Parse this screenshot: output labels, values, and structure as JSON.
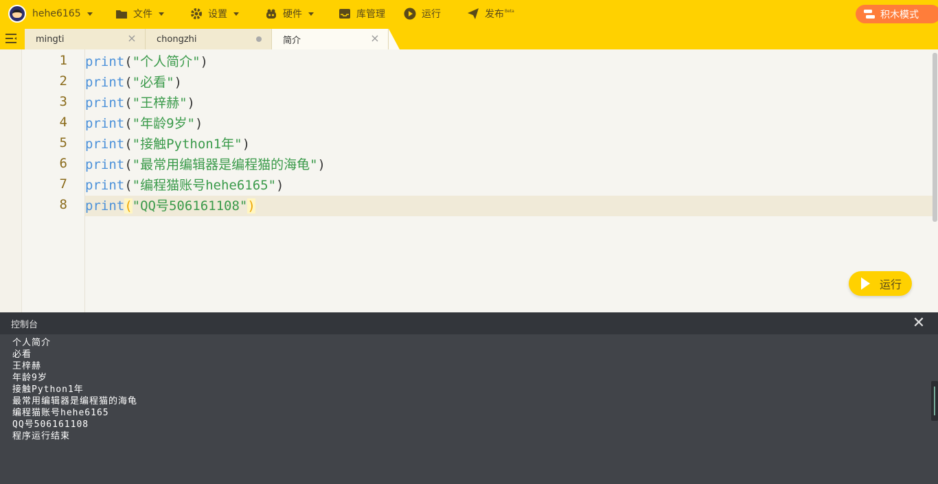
{
  "toolbar": {
    "username": "hehe6165",
    "file": "文件",
    "settings": "设置",
    "hardware": "硬件",
    "library": "库管理",
    "run": "运行",
    "publish": "发布",
    "publish_badge": "Beta",
    "brick_mode": "积木模式"
  },
  "tabs": [
    {
      "label": "mingti",
      "state": "close"
    },
    {
      "label": "chongzhi",
      "state": "modified"
    },
    {
      "label": "简介",
      "state": "close",
      "active": true
    }
  ],
  "editor": {
    "lines": [
      {
        "num": "1",
        "kw": "print",
        "open": "(",
        "str": "\"个人简介\"",
        "close": ")"
      },
      {
        "num": "2",
        "kw": "print",
        "open": "(",
        "str": "\"必看\"",
        "close": ")"
      },
      {
        "num": "3",
        "kw": "print",
        "open": "(",
        "str": "\"王梓赫\"",
        "close": ")"
      },
      {
        "num": "4",
        "kw": "print",
        "open": "(",
        "str": "\"年龄9岁\"",
        "close": ")"
      },
      {
        "num": "5",
        "kw": "print",
        "open": "(",
        "str": "\"接触Python1年\"",
        "close": ")"
      },
      {
        "num": "6",
        "kw": "print",
        "open": "(",
        "str": "\"最常用编辑器是编程猫的海龟\"",
        "close": ")"
      },
      {
        "num": "7",
        "kw": "print",
        "open": "(",
        "str": "\"编程猫账号hehe6165\"",
        "close": ")"
      },
      {
        "num": "8",
        "kw": "print",
        "open": "(",
        "str": "\"QQ号506161108\"",
        "close": ")"
      }
    ],
    "current_line": 8,
    "run_button": "运行"
  },
  "console": {
    "title": "控制台",
    "output": [
      "个人简介",
      "必看",
      "王梓赫",
      "年龄9岁",
      "接触Python1年",
      "最常用编辑器是编程猫的海龟",
      "编程猫账号hehe6165",
      "QQ号506161108",
      "程序运行结束"
    ]
  },
  "colors": {
    "accent": "#ffd100",
    "brick_mode_button": "#ff7d3a",
    "keyword": "#4a90d9",
    "string": "#3a9a4a",
    "console_bg": "#414449"
  }
}
